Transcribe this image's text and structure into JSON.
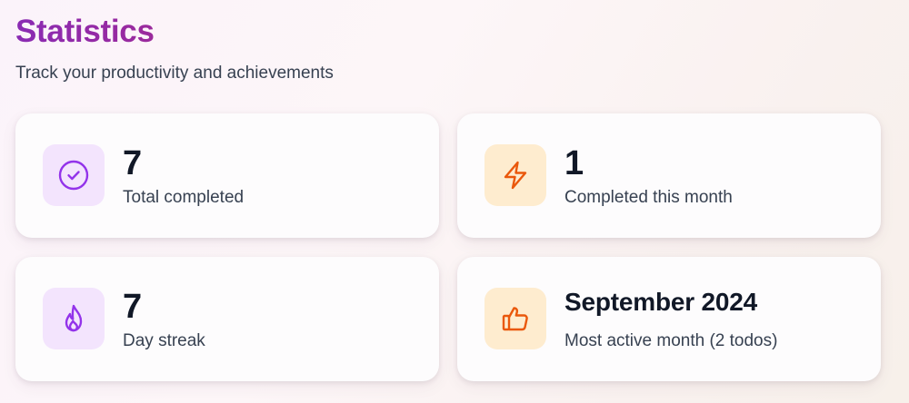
{
  "header": {
    "title": "Statistics",
    "subtitle": "Track your productivity and achievements"
  },
  "cards": [
    {
      "value": "7",
      "label": "Total completed",
      "icon": "check-circle-icon",
      "accent": "#9333ea"
    },
    {
      "value": "1",
      "label": "Completed this month",
      "icon": "lightning-bolt-icon",
      "accent": "#ea580c"
    },
    {
      "value": "7",
      "label": "Day streak",
      "icon": "flame-icon",
      "accent": "#9333ea"
    },
    {
      "value": "September 2024",
      "label": "Most active month (2 todos)",
      "icon": "thumbs-up-icon",
      "accent": "#ea580c"
    }
  ],
  "colors": {
    "title_gradient_start": "#8a2bb3",
    "title_gradient_end": "#9b2a9c",
    "purple_icon_bg": "#f3e4fd",
    "orange_icon_bg": "#feeccf"
  }
}
